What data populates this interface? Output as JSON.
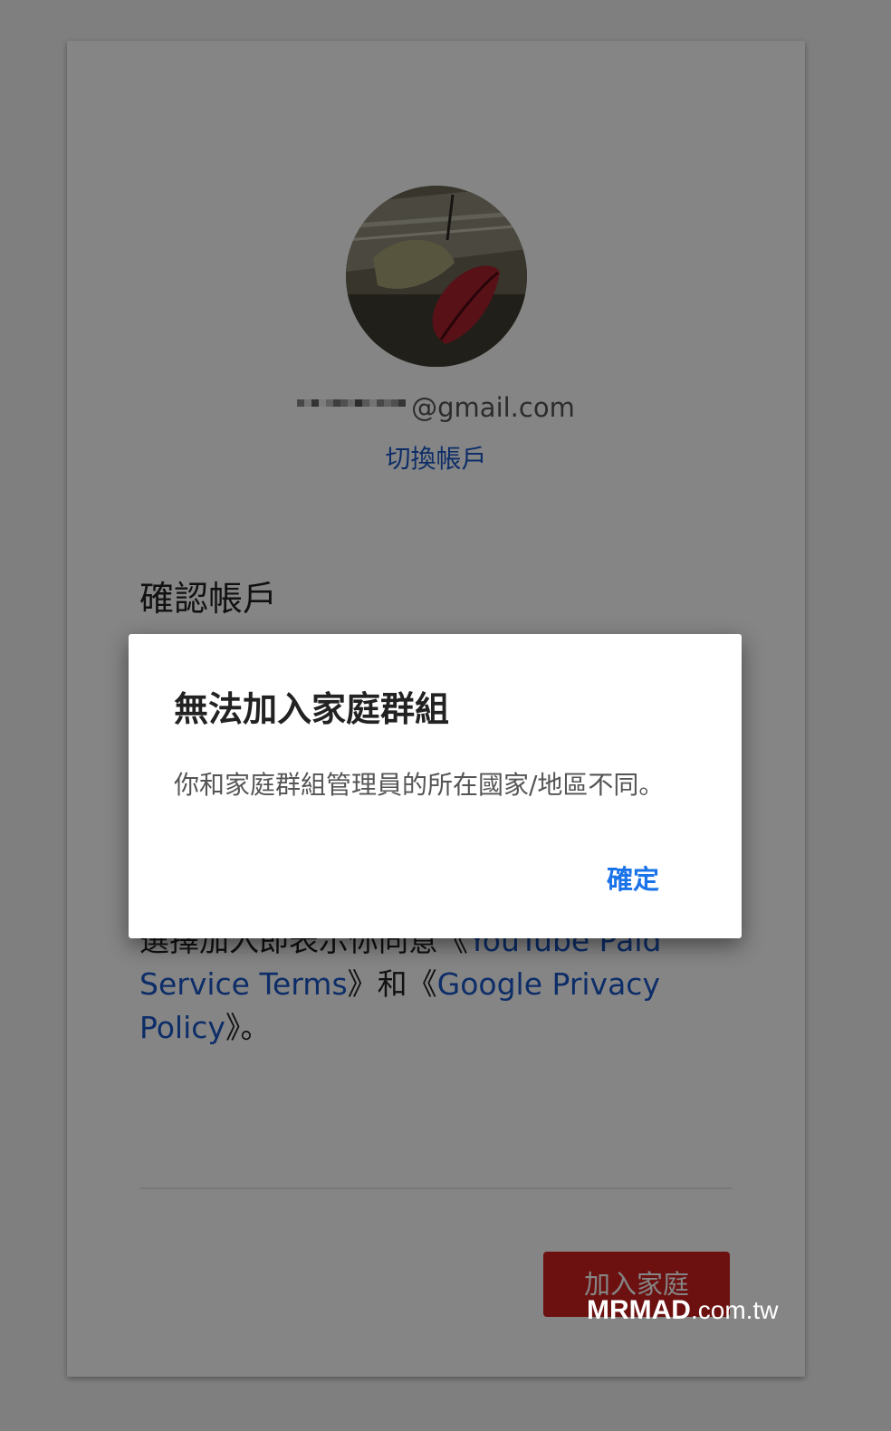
{
  "account": {
    "avatar": "user-avatar",
    "email_suffix": "@gmail.com",
    "switch_account": "切換帳戶"
  },
  "section": {
    "title": "確認帳戶"
  },
  "terms": {
    "prefix": "選擇加入即表示你同意《",
    "link1": "YouTube Paid Service Terms",
    "mid": "》和《",
    "link2": "Google Privacy Policy",
    "suffix": "》。"
  },
  "primary_button": "加入家庭",
  "dialog": {
    "title": "無法加入家庭群組",
    "message": "你和家庭群組管理員的所在國家/地區不同。",
    "ok_label": "確定"
  },
  "watermark": {
    "brand": "MRMAD",
    "domain": ".com.tw"
  },
  "colors": {
    "link": "#1a57c7",
    "accent_button": "#cf1f1f",
    "dialog_action": "#1a73e8"
  }
}
